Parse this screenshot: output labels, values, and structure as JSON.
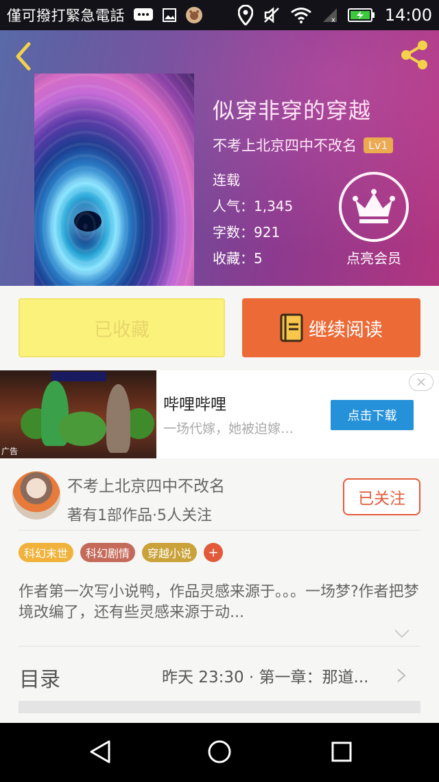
{
  "status_bar": {
    "notice": "僅可撥打緊急電話",
    "time": "14:00",
    "icons": [
      "message-icon",
      "image-icon",
      "app-icon",
      "location-icon",
      "mute-icon",
      "wifi-icon",
      "signal-icon",
      "battery-icon"
    ]
  },
  "header": {
    "book_title": "似穿非穿的穿越",
    "author": "不考上北京四中不改名",
    "level": "Lv1",
    "status": "连载",
    "popularity": "人气：1,345",
    "word_count": "字数：921",
    "favorites": "收藏：5",
    "vip_label": "点亮会员"
  },
  "actions": {
    "collected_label": "已收藏",
    "continue_label": "继续阅读"
  },
  "ad": {
    "tag": "广告",
    "title": "哔哩哔哩",
    "description": "一场代嫁，她被迫嫁…",
    "download_label": "点击下载"
  },
  "author_card": {
    "name": "不考上北京四中不改名",
    "stats": "著有1部作品·5人关注",
    "follow_label": "已关注"
  },
  "tags": [
    {
      "label": "科幻末世",
      "color": "#f0b23a"
    },
    {
      "label": "科幻剧情",
      "color": "#c46a5a"
    },
    {
      "label": "穿越小说",
      "color": "#c9a23a"
    }
  ],
  "tag_more": "+",
  "description": "作者第一次写小说鸭，作品灵感来源于。。。一场梦?作者把梦境改编了，还有些灵感来源于动...",
  "toc": {
    "title": "目录",
    "latest": "昨天 23:30 · 第一章：那道..."
  },
  "colors": {
    "accent_orange": "#ec6a36",
    "collected_yellow": "#fbf27c",
    "follow_red": "#e25a3a",
    "ad_blue": "#2591d9"
  }
}
